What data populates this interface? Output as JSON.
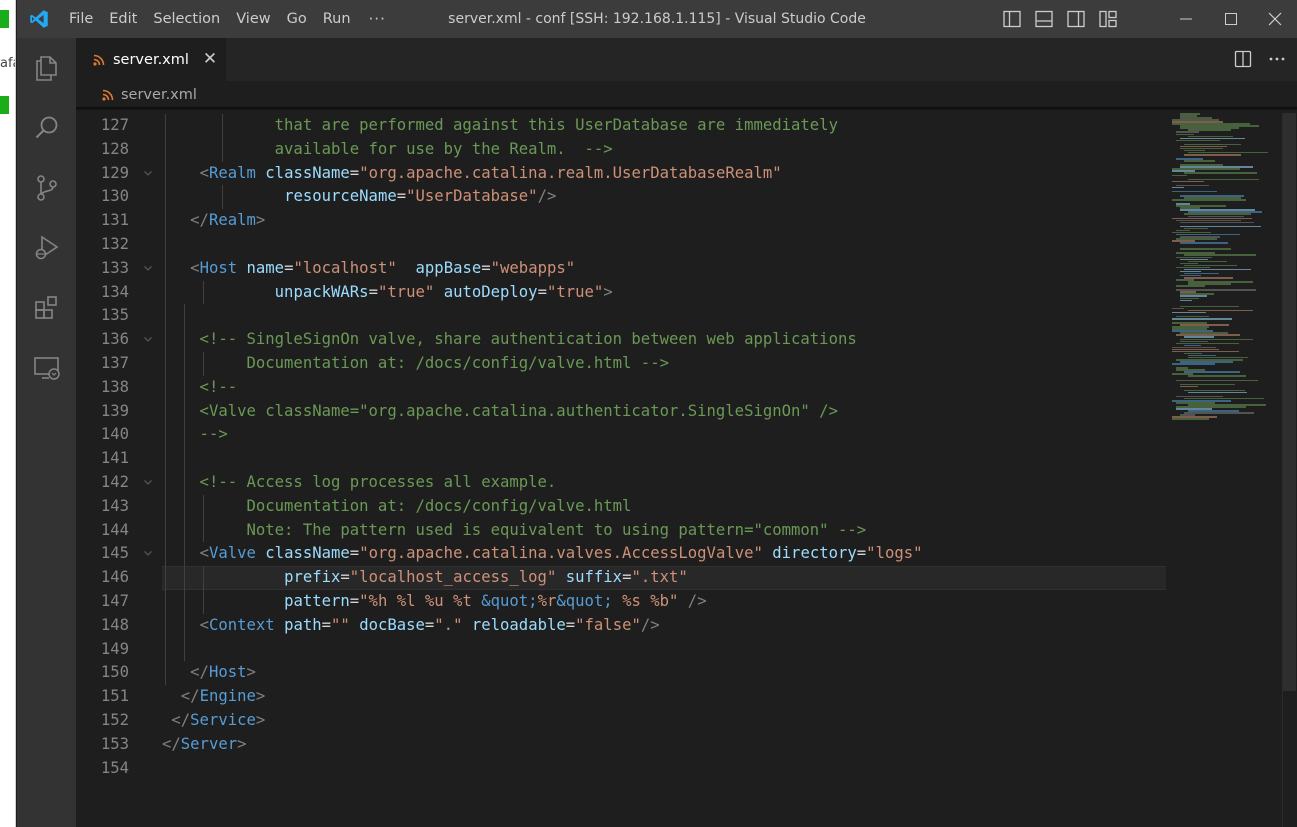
{
  "window": {
    "title": "server.xml - conf [SSH: 192.168.1.115] - Visual Studio Code",
    "menu": [
      "File",
      "Edit",
      "Selection",
      "View",
      "Go",
      "Run"
    ],
    "menu_more": "···"
  },
  "background_window": {
    "text": "afa"
  },
  "activity_bar": [
    "files-icon",
    "search-icon",
    "source-control-icon",
    "run-debug-icon",
    "extensions-icon",
    "remote-explorer-icon"
  ],
  "tab": {
    "label": "server.xml",
    "close_glyph": "✕"
  },
  "breadcrumb": {
    "label": "server.xml"
  },
  "editor": {
    "current_line": 146,
    "lines": [
      {
        "n": "127",
        "fold": false,
        "guides": [
          148,
          205
        ],
        "tokens": [
          {
            "t": "            that are performed against this UserDatabase are immediately",
            "c": "cm"
          }
        ]
      },
      {
        "n": "128",
        "fold": false,
        "guides": [
          148,
          205
        ],
        "tokens": [
          {
            "t": "            available for use by the Realm.  -->",
            "c": "cm"
          }
        ]
      },
      {
        "n": "129",
        "fold": true,
        "guides": [
          148
        ],
        "tokens": [
          {
            "t": "    ",
            "c": ""
          },
          {
            "t": "<",
            "c": "tg"
          },
          {
            "t": "Realm",
            "c": "tn"
          },
          {
            "t": " ",
            "c": ""
          },
          {
            "t": "className",
            "c": "at"
          },
          {
            "t": "=",
            "c": "eq"
          },
          {
            "t": "\"org.apache.catalina.realm.UserDatabaseRealm\"",
            "c": "vl"
          }
        ]
      },
      {
        "n": "130",
        "fold": false,
        "guides": [
          148,
          205
        ],
        "tokens": [
          {
            "t": "             ",
            "c": ""
          },
          {
            "t": "resourceName",
            "c": "at"
          },
          {
            "t": "=",
            "c": "eq"
          },
          {
            "t": "\"UserDatabase\"",
            "c": "vl"
          },
          {
            "t": "/>",
            "c": "tg"
          }
        ]
      },
      {
        "n": "131",
        "fold": false,
        "guides": [
          148
        ],
        "tokens": [
          {
            "t": "   ",
            "c": ""
          },
          {
            "t": "</",
            "c": "tg"
          },
          {
            "t": "Realm",
            "c": "tn"
          },
          {
            "t": ">",
            "c": "tg"
          }
        ]
      },
      {
        "n": "132",
        "fold": false,
        "guides": [
          148
        ],
        "tokens": []
      },
      {
        "n": "133",
        "fold": true,
        "guides": [
          148
        ],
        "tokens": [
          {
            "t": "   ",
            "c": ""
          },
          {
            "t": "<",
            "c": "tg"
          },
          {
            "t": "Host",
            "c": "tn"
          },
          {
            "t": " ",
            "c": ""
          },
          {
            "t": "name",
            "c": "at"
          },
          {
            "t": "=",
            "c": "eq"
          },
          {
            "t": "\"localhost\"",
            "c": "vl"
          },
          {
            "t": "  ",
            "c": ""
          },
          {
            "t": "appBase",
            "c": "at"
          },
          {
            "t": "=",
            "c": "eq"
          },
          {
            "t": "\"webapps\"",
            "c": "vl"
          }
        ]
      },
      {
        "n": "134",
        "fold": false,
        "guides": [
          148,
          186
        ],
        "tokens": [
          {
            "t": "            ",
            "c": ""
          },
          {
            "t": "unpackWARs",
            "c": "at"
          },
          {
            "t": "=",
            "c": "eq"
          },
          {
            "t": "\"true\"",
            "c": "vl"
          },
          {
            "t": " ",
            "c": ""
          },
          {
            "t": "autoDeploy",
            "c": "at"
          },
          {
            "t": "=",
            "c": "eq"
          },
          {
            "t": "\"true\"",
            "c": "vl"
          },
          {
            "t": ">",
            "c": "tg"
          }
        ]
      },
      {
        "n": "135",
        "fold": false,
        "guides": [
          148,
          167
        ],
        "tokens": []
      },
      {
        "n": "136",
        "fold": true,
        "guides": [
          148,
          167
        ],
        "tokens": [
          {
            "t": "    <!-- SingleSignOn valve, share authentication between web applications",
            "c": "cm"
          }
        ]
      },
      {
        "n": "137",
        "fold": false,
        "guides": [
          148,
          167,
          186
        ],
        "tokens": [
          {
            "t": "         Documentation at: /docs/config/valve.html -->",
            "c": "cm"
          }
        ]
      },
      {
        "n": "138",
        "fold": false,
        "guides": [
          148,
          167
        ],
        "tokens": [
          {
            "t": "    <!--",
            "c": "cm"
          }
        ]
      },
      {
        "n": "139",
        "fold": false,
        "guides": [
          148,
          167
        ],
        "tokens": [
          {
            "t": "    <Valve className=\"org.apache.catalina.authenticator.SingleSignOn\" />",
            "c": "cm"
          }
        ]
      },
      {
        "n": "140",
        "fold": false,
        "guides": [
          148,
          167
        ],
        "tokens": [
          {
            "t": "    -->",
            "c": "cm"
          }
        ]
      },
      {
        "n": "141",
        "fold": false,
        "guides": [
          148,
          167
        ],
        "tokens": []
      },
      {
        "n": "142",
        "fold": true,
        "guides": [
          148,
          167
        ],
        "tokens": [
          {
            "t": "    <!-- Access log processes all example.",
            "c": "cm"
          }
        ]
      },
      {
        "n": "143",
        "fold": false,
        "guides": [
          148,
          167,
          186
        ],
        "tokens": [
          {
            "t": "         Documentation at: /docs/config/valve.html",
            "c": "cm"
          }
        ]
      },
      {
        "n": "144",
        "fold": false,
        "guides": [
          148,
          167,
          186
        ],
        "tokens": [
          {
            "t": "         Note: The pattern used is equivalent to using pattern=\"common\" -->",
            "c": "cm"
          }
        ]
      },
      {
        "n": "145",
        "fold": true,
        "guides": [
          148,
          167
        ],
        "tokens": [
          {
            "t": "    ",
            "c": ""
          },
          {
            "t": "<",
            "c": "tg"
          },
          {
            "t": "Valve",
            "c": "tn"
          },
          {
            "t": " ",
            "c": ""
          },
          {
            "t": "className",
            "c": "at"
          },
          {
            "t": "=",
            "c": "eq"
          },
          {
            "t": "\"org.apache.catalina.valves.AccessLogValve\"",
            "c": "vl"
          },
          {
            "t": " ",
            "c": ""
          },
          {
            "t": "directory",
            "c": "at"
          },
          {
            "t": "=",
            "c": "eq"
          },
          {
            "t": "\"logs\"",
            "c": "vl"
          }
        ]
      },
      {
        "n": "146",
        "fold": false,
        "guides": [
          148,
          167,
          186
        ],
        "tokens": [
          {
            "t": "             ",
            "c": ""
          },
          {
            "t": "prefix",
            "c": "at"
          },
          {
            "t": "=",
            "c": "eq"
          },
          {
            "t": "\"localhost_access_log\"",
            "c": "vl"
          },
          {
            "t": " ",
            "c": ""
          },
          {
            "t": "suffix",
            "c": "at"
          },
          {
            "t": "=",
            "c": "eq"
          },
          {
            "t": "\".txt\"",
            "c": "vl"
          }
        ]
      },
      {
        "n": "147",
        "fold": false,
        "guides": [
          148,
          167,
          186
        ],
        "tokens": [
          {
            "t": "             ",
            "c": ""
          },
          {
            "t": "pattern",
            "c": "at"
          },
          {
            "t": "=",
            "c": "eq"
          },
          {
            "t": "\"%h %l %u %t ",
            "c": "vl"
          },
          {
            "t": "&quot;",
            "c": "en"
          },
          {
            "t": "%r",
            "c": "vl"
          },
          {
            "t": "&quot;",
            "c": "en"
          },
          {
            "t": " %s %b\"",
            "c": "vl"
          },
          {
            "t": " />",
            "c": "tg"
          }
        ]
      },
      {
        "n": "148",
        "fold": false,
        "guides": [
          148,
          167
        ],
        "tokens": [
          {
            "t": "    ",
            "c": ""
          },
          {
            "t": "<",
            "c": "tg"
          },
          {
            "t": "Context",
            "c": "tn"
          },
          {
            "t": " ",
            "c": ""
          },
          {
            "t": "path",
            "c": "at"
          },
          {
            "t": "=",
            "c": "eq"
          },
          {
            "t": "\"\"",
            "c": "vl"
          },
          {
            "t": " ",
            "c": ""
          },
          {
            "t": "docBase",
            "c": "at"
          },
          {
            "t": "=",
            "c": "eq"
          },
          {
            "t": "\".\"",
            "c": "vl"
          },
          {
            "t": " ",
            "c": ""
          },
          {
            "t": "reloadable",
            "c": "at"
          },
          {
            "t": "=",
            "c": "eq"
          },
          {
            "t": "\"false\"",
            "c": "vl"
          },
          {
            "t": "/>",
            "c": "tg"
          }
        ]
      },
      {
        "n": "149",
        "fold": false,
        "guides": [
          148,
          167
        ],
        "tokens": []
      },
      {
        "n": "150",
        "fold": false,
        "guides": [
          148
        ],
        "tokens": [
          {
            "t": "   ",
            "c": ""
          },
          {
            "t": "</",
            "c": "tg"
          },
          {
            "t": "Host",
            "c": "tn"
          },
          {
            "t": ">",
            "c": "tg"
          }
        ]
      },
      {
        "n": "151",
        "fold": false,
        "guides": [],
        "tokens": [
          {
            "t": "  ",
            "c": ""
          },
          {
            "t": "</",
            "c": "tg"
          },
          {
            "t": "Engine",
            "c": "tn"
          },
          {
            "t": ">",
            "c": "tg"
          }
        ]
      },
      {
        "n": "152",
        "fold": false,
        "guides": [],
        "tokens": [
          {
            "t": " ",
            "c": ""
          },
          {
            "t": "</",
            "c": "tg"
          },
          {
            "t": "Service",
            "c": "tn"
          },
          {
            "t": ">",
            "c": "tg"
          }
        ]
      },
      {
        "n": "153",
        "fold": false,
        "guides": [],
        "tokens": [
          {
            "t": "</",
            "c": "tg"
          },
          {
            "t": "Server",
            "c": "tn"
          },
          {
            "t": ">",
            "c": "tg"
          }
        ]
      },
      {
        "n": "154",
        "fold": false,
        "guides": [],
        "tokens": []
      }
    ]
  },
  "colors": {
    "titlebar": "#3c3c3c",
    "activitybar": "#333333",
    "editor_bg": "#1e1e1e",
    "tag": "#569cd6",
    "attribute": "#9cdcfe",
    "string": "#ce9178",
    "comment": "#6a9955",
    "accent": "#007acc"
  }
}
